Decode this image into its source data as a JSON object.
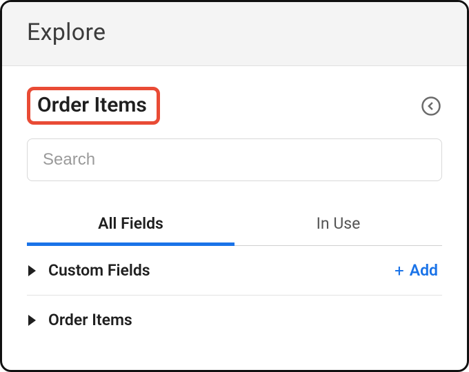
{
  "header": {
    "title": "Explore"
  },
  "panel": {
    "title": "Order Items"
  },
  "search": {
    "placeholder": "Search"
  },
  "tabs": {
    "all_fields": "All Fields",
    "in_use": "In Use"
  },
  "sections": {
    "custom_fields": {
      "label": "Custom Fields",
      "add_label": "Add"
    },
    "order_items": {
      "label": "Order Items"
    }
  },
  "colors": {
    "accent": "#1a73e8",
    "highlight": "#e94b35"
  }
}
